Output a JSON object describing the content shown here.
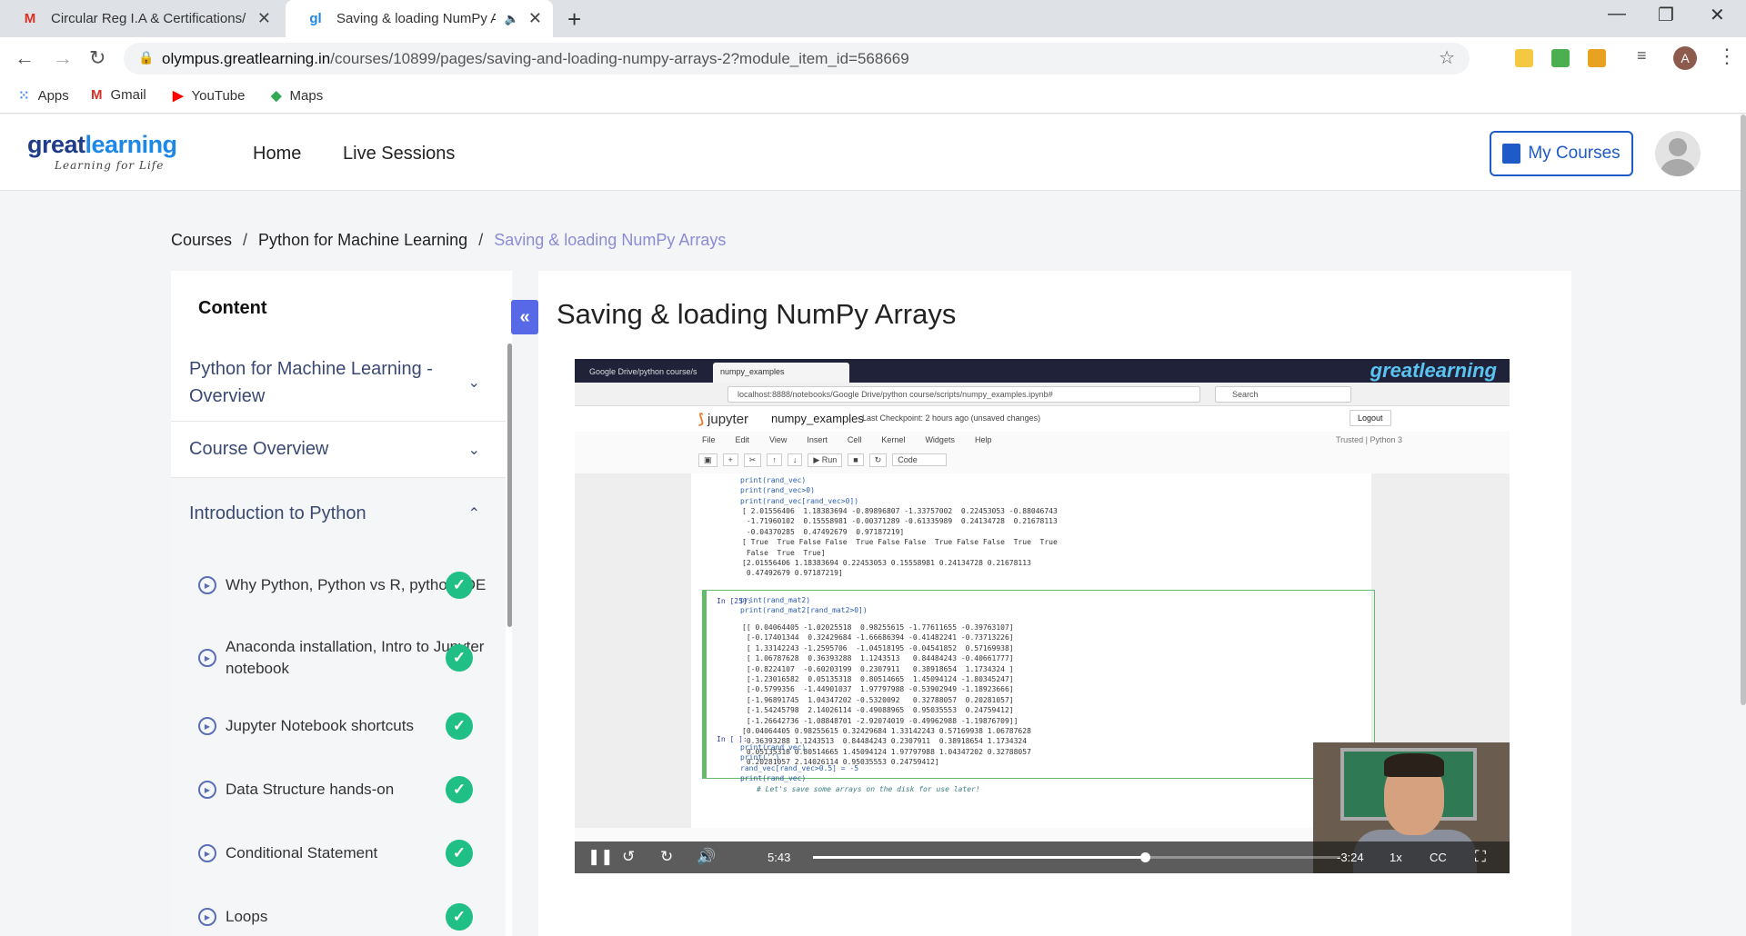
{
  "browser": {
    "tabs": [
      {
        "title": "Circular Reg I.A & Certifications/",
        "favicon": "gmail-icon"
      },
      {
        "title": "Saving & loading NumPy Arr",
        "favicon": "greatlearning-icon"
      }
    ],
    "url_domain": "olympus.greatlearning.in",
    "url_path": "/courses/10899/pages/saving-and-loading-numpy-arrays-2?module_item_id=568669",
    "profile_initial": "A",
    "bookmarks": [
      "Apps",
      "Gmail",
      "YouTube",
      "Maps"
    ]
  },
  "site": {
    "logo_main_a": "great",
    "logo_main_b": "learning",
    "logo_tagline": "Learning for Life",
    "nav": [
      "Home",
      "Live Sessions"
    ],
    "my_courses_label": "My Courses"
  },
  "breadcrumb": {
    "items": [
      "Courses",
      "Python for Machine Learning"
    ],
    "current": "Saving & loading NumPy Arrays",
    "separator": "/"
  },
  "sidebar": {
    "heading": "Content",
    "sections": [
      {
        "label": "Python for Machine Learning - Overview",
        "expanded": false
      },
      {
        "label": "Course Overview",
        "expanded": false
      },
      {
        "label": "Introduction to Python",
        "expanded": true
      }
    ],
    "lessons": [
      {
        "label": "Why Python, Python vs R, python IDE",
        "completed": true
      },
      {
        "label": "Anaconda installation, Intro to Jupyter notebook",
        "completed": true
      },
      {
        "label": "Jupyter Notebook shortcuts",
        "completed": true
      },
      {
        "label": "Data Structure hands-on",
        "completed": true
      },
      {
        "label": "Conditional Statement",
        "completed": true
      },
      {
        "label": "Loops",
        "completed": true
      }
    ]
  },
  "main": {
    "title": "Saving & loading NumPy Arrays"
  },
  "video": {
    "tabs": [
      "Google Drive/python course/s",
      "numpy_examples"
    ],
    "brand": "greatlearning",
    "url": "localhost:8888/notebooks/Google Drive/python course/scripts/numpy_examples.ipynb#",
    "search_placeholder": "Search",
    "jupyter_brand": "jupyter",
    "notebook_name": "numpy_examples",
    "checkpoint": "Last Checkpoint: 2 hours ago   (unsaved changes)",
    "logout": "Logout",
    "menu": [
      "File",
      "Edit",
      "View",
      "Insert",
      "Cell",
      "Kernel",
      "Widgets",
      "Help"
    ],
    "menu_right": "Trusted   |  Python 3",
    "toolbar_run": "Run",
    "toolbar_celltype": "Code",
    "code_top": "print(rand_vec)\nprint(rand_vec>0)\nprint(rand_vec[rand_vec>0])",
    "output_top": "[ 2.01556406  1.18383694 -0.89896807 -1.33757002  0.22453053 -0.88046743\n -1.71960102  0.15558981 -0.00371289 -0.61335989  0.24134728  0.21678113\n -0.04370285  0.47492679  0.97187219]\n[ True  True False False  True False False  True False False  True  True\n False  True  True]\n[2.01556406 1.18383694 0.22453053 0.15558981 0.24134728 0.21678113\n 0.47492679 0.97187219]",
    "prompt_25": "In [25]:",
    "code_mid": "print(rand_mat2)\nprint(rand_mat2[rand_mat2>0])",
    "output_mid": "[[ 0.04064405 -1.02025518  0.98255615 -1.77611655 -0.39763107]\n [-0.17401344  0.32429684 -1.66686394 -0.41482241 -0.73713226]\n [ 1.33142243 -1.2595706  -1.04518195 -0.04541852  0.57169938]\n [ 1.06787628  0.36393288  1.1243513   0.84484243 -0.40661777]\n [-0.8224107  -0.60203199  0.2307911   0.38918654  1.1734324 ]\n [-1.23016582  0.05135318  0.80514665  1.45094124 -1.80345247]\n [-0.5799356  -1.44901037  1.97797988 -0.53902949 -1.18923666]\n [-1.96891745  1.04347202 -0.5320092   0.32788057  0.20281057]\n [-1.54245798  2.14026114 -0.49088965  0.95035553  0.24759412]\n [-1.26642736 -1.08848701 -2.92074019 -0.49962988 -1.19876709]]\n[0.04064405 0.98255615 0.32429684 1.33142243 0.57169938 1.06787628\n 0.36393288 1.1243513  0.84484243 0.2307911  0.38918654 1.1734324\n 0.05135318 0.80514665 1.45094124 1.97797988 1.04347202 0.32788057\n 0.20281057 2.14026114 0.95035553 0.24759412]",
    "prompt_empty": "In [ ]:",
    "code_bottom": "print(rand_vec)\nprint('')\nrand_vec[rand_vec>0.5] = -5\nprint(rand_vec)",
    "comment_line": "# Let's save some arrays on the disk for use later!",
    "elapsed": "5:43",
    "remaining": "-3:24",
    "speed": "1x",
    "progress": 0.63
  }
}
